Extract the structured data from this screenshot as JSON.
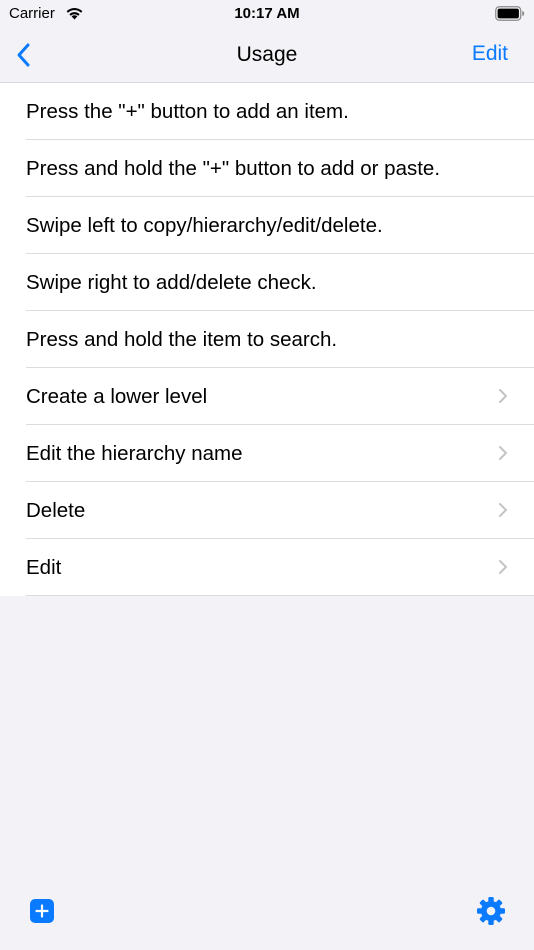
{
  "status_bar": {
    "carrier": "Carrier",
    "time": "10:17 AM",
    "wifi_icon": "wifi-icon",
    "battery_icon": "battery-icon"
  },
  "nav": {
    "back_icon": "chevron-left-icon",
    "title": "Usage",
    "edit_label": "Edit"
  },
  "list": {
    "items": [
      {
        "label": "Press the \"+\" button to add an item.",
        "has_disclosure": false
      },
      {
        "label": "Press and hold the \"+\" button to add or paste.",
        "has_disclosure": false
      },
      {
        "label": "Swipe left to copy/hierarchy/edit/delete.",
        "has_disclosure": false
      },
      {
        "label": "Swipe right to add/delete check.",
        "has_disclosure": false
      },
      {
        "label": "Press and hold the item to search.",
        "has_disclosure": false
      },
      {
        "label": "Create a lower level",
        "has_disclosure": true
      },
      {
        "label": "Edit the hierarchy name",
        "has_disclosure": true
      },
      {
        "label": "Delete",
        "has_disclosure": true
      },
      {
        "label": "Edit",
        "has_disclosure": true
      }
    ]
  },
  "toolbar": {
    "add_icon": "plus-icon",
    "settings_icon": "gear-icon"
  },
  "colors": {
    "accent": "#0a7aff",
    "background": "#f2f2f7",
    "row_background": "#ffffff",
    "separator": "#dcdce0",
    "chevron": "#c4c4c7"
  }
}
